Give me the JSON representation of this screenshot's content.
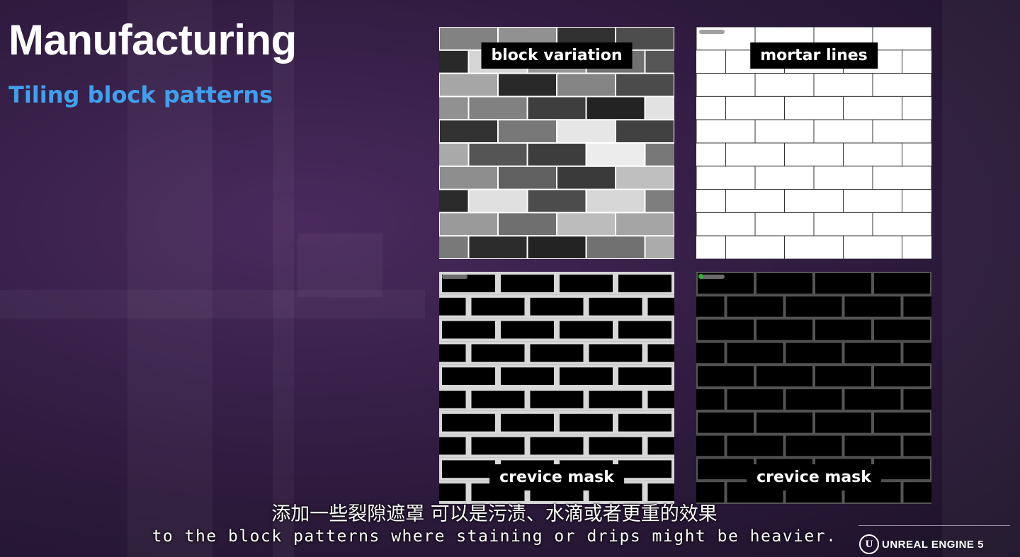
{
  "slide": {
    "title": "Manufacturing",
    "subtitle": "Tiling block patterns",
    "title_color": "#ffffff",
    "subtitle_color": "#3fa0ee"
  },
  "panels": [
    {
      "label": "block variation",
      "kind": "block-variation"
    },
    {
      "label": "mortar lines",
      "kind": "mortar-lines"
    },
    {
      "label": "crevice mask",
      "kind": "crevice-mask-strong"
    },
    {
      "label": "crevice mask",
      "kind": "crevice-mask-soft"
    }
  ],
  "captions": {
    "chinese": "添加一些裂隙遮罩 可以是污渍、水滴或者更重的效果",
    "english": "to the block patterns where staining or drips might be heavier."
  },
  "branding": {
    "logo_mark": "U",
    "logo_text": "UNREAL ENGINE 5",
    "logo_icon": "unreal-engine-logo-icon"
  }
}
